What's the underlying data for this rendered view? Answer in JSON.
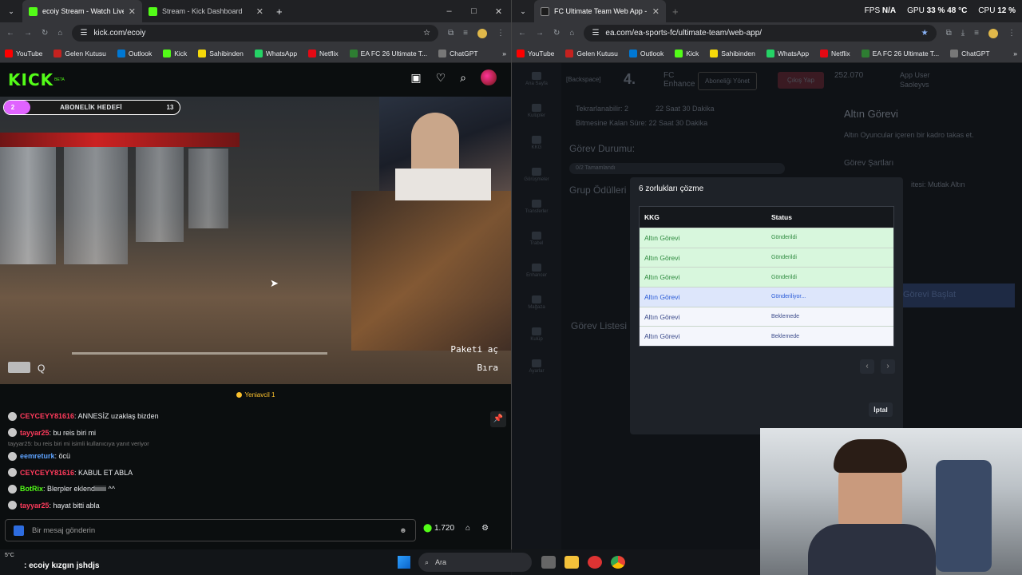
{
  "left_browser": {
    "tabs": [
      {
        "title": "ecoiy Stream - Watch Live o",
        "active": true
      },
      {
        "title": "Stream - Kick Dashboard",
        "active": false
      }
    ],
    "new_tab": "+",
    "url": "kick.com/ecoiy",
    "window_controls": {
      "minimize": "–",
      "maximize": "□",
      "close": "✕"
    }
  },
  "bookmarks": [
    "YouTube",
    "Gelen Kutusu",
    "Outlook",
    "Kick",
    "Sahibinden",
    "WhatsApp",
    "Netflix",
    "EA FC 26 Ultimate T...",
    "ChatGPT"
  ],
  "kick": {
    "logo": "KICK",
    "beta": "BETA",
    "sub_goal": {
      "current": "2",
      "label": "ABONELİK HEDEFİ",
      "target": "13",
      "progress": 0.15
    },
    "game_text_1": "Paketi aç",
    "game_text_2": "Bıra",
    "hud_key": "Q",
    "viewer_label": "Yeniavcil 1",
    "chat": [
      {
        "user": "CEYCEYY81616",
        "text": ": ANNESİZ uzaklaş bizden",
        "color": "#ff3b5c"
      },
      {
        "user": "tayyar25",
        "text": ": bu reis biri mi",
        "color": "#ff3b5c"
      },
      {
        "reply": "tayyar25: bu reis biri mi isimli kullanıcıya yanıt veriyor"
      },
      {
        "user": "eemreturk",
        "text": ": öcü",
        "color": "#5ea3ff"
      },
      {
        "user": "CEYCEYY81616",
        "text": ": KABUL ET ABLA",
        "color": "#ff3b5c"
      },
      {
        "user": "BotRix",
        "text": ": Blerpler eklendiiiiiii ^^",
        "color": "#53fc18"
      },
      {
        "user": "tayyar25",
        "text": ": hayat bitti abla",
        "color": "#ff3b5c"
      }
    ],
    "chat_placeholder": "Bir mesaj gönderin",
    "points": "1.720"
  },
  "right_browser": {
    "tab_title": "FC Ultimate Team Web App - E",
    "url": "ea.com/ea-sports-fc/ultimate-team/web-app/",
    "stats": {
      "fps_label": "FPS",
      "fps_value": "N/A",
      "gpu_label": "GPU",
      "gpu_value": "33 % 48 °C",
      "cpu_label": "CPU",
      "cpu_value": "12 %"
    }
  },
  "fc": {
    "tekrarlanabilir": "Tekrarlanabilir: 2",
    "sure1": "22 Saat 30 Dakika",
    "bitmesine": "Bitmesine Kalan Süre: 22 Saat 30 Dakika",
    "gorev_durumu": "Görev Durumu:",
    "tamamlandi": "0/2 Tamamlandı",
    "grup": "Grup Ödülleri",
    "gorev_listesi": "Görev Listesi",
    "altin_gorevi_title": "Altın Görevi",
    "altin_desc": "Altın Oyuncular içeren bir kadro takas et.",
    "gorev_sartlari": "Görev Şartları",
    "mutlak": "itesi: Mutlak Altın",
    "gorevi_baslat": "Görevi Başlat",
    "backspace": "[Backspace]",
    "coins": "252.070",
    "app_user": "App User",
    "app_user2": "Saoleyvs",
    "abonelik": "Aboneliği Yönet",
    "cikis": "Çıkış Yap",
    "fc_enh": "FC Enhance",
    "num": "4.",
    "sidebar": [
      "Ana Sayfa",
      "Kulüpler",
      "KKG",
      "Görüşmeler",
      "Transferler",
      "Trabel",
      "Enhancer",
      "Mağaza",
      "Kulüp",
      "Ayarlar"
    ],
    "modal": {
      "title": "6 zorlukları çözme",
      "headers": [
        "KKG",
        "Status"
      ],
      "rows": [
        {
          "name": "Altın Görevi",
          "status": "Gönderildi",
          "bg": "#d8f7dd",
          "fg": "#2d8a3e"
        },
        {
          "name": "Altın Görevi",
          "status": "Gönderildi",
          "bg": "#d8f7dd",
          "fg": "#2d8a3e"
        },
        {
          "name": "Altın Görevi",
          "status": "Gönderildi",
          "bg": "#d8f7dd",
          "fg": "#2d8a3e"
        },
        {
          "name": "Altın Görevi",
          "status": "Gönderiliyor...",
          "bg": "#dde6fb",
          "fg": "#2a5bd7"
        },
        {
          "name": "Altın Görevi",
          "status": "Beklemede",
          "bg": "#f4f6fc",
          "fg": "#3a4a8a"
        },
        {
          "name": "Altın Görevi",
          "status": "Beklemede",
          "bg": "#f4f6fc",
          "fg": "#3a4a8a"
        }
      ],
      "cancel": "İptal"
    }
  },
  "taskbar": {
    "weather": "5°C",
    "search": "Ara",
    "overlay_chat": ": ecoiy kızgın jshdjs"
  }
}
